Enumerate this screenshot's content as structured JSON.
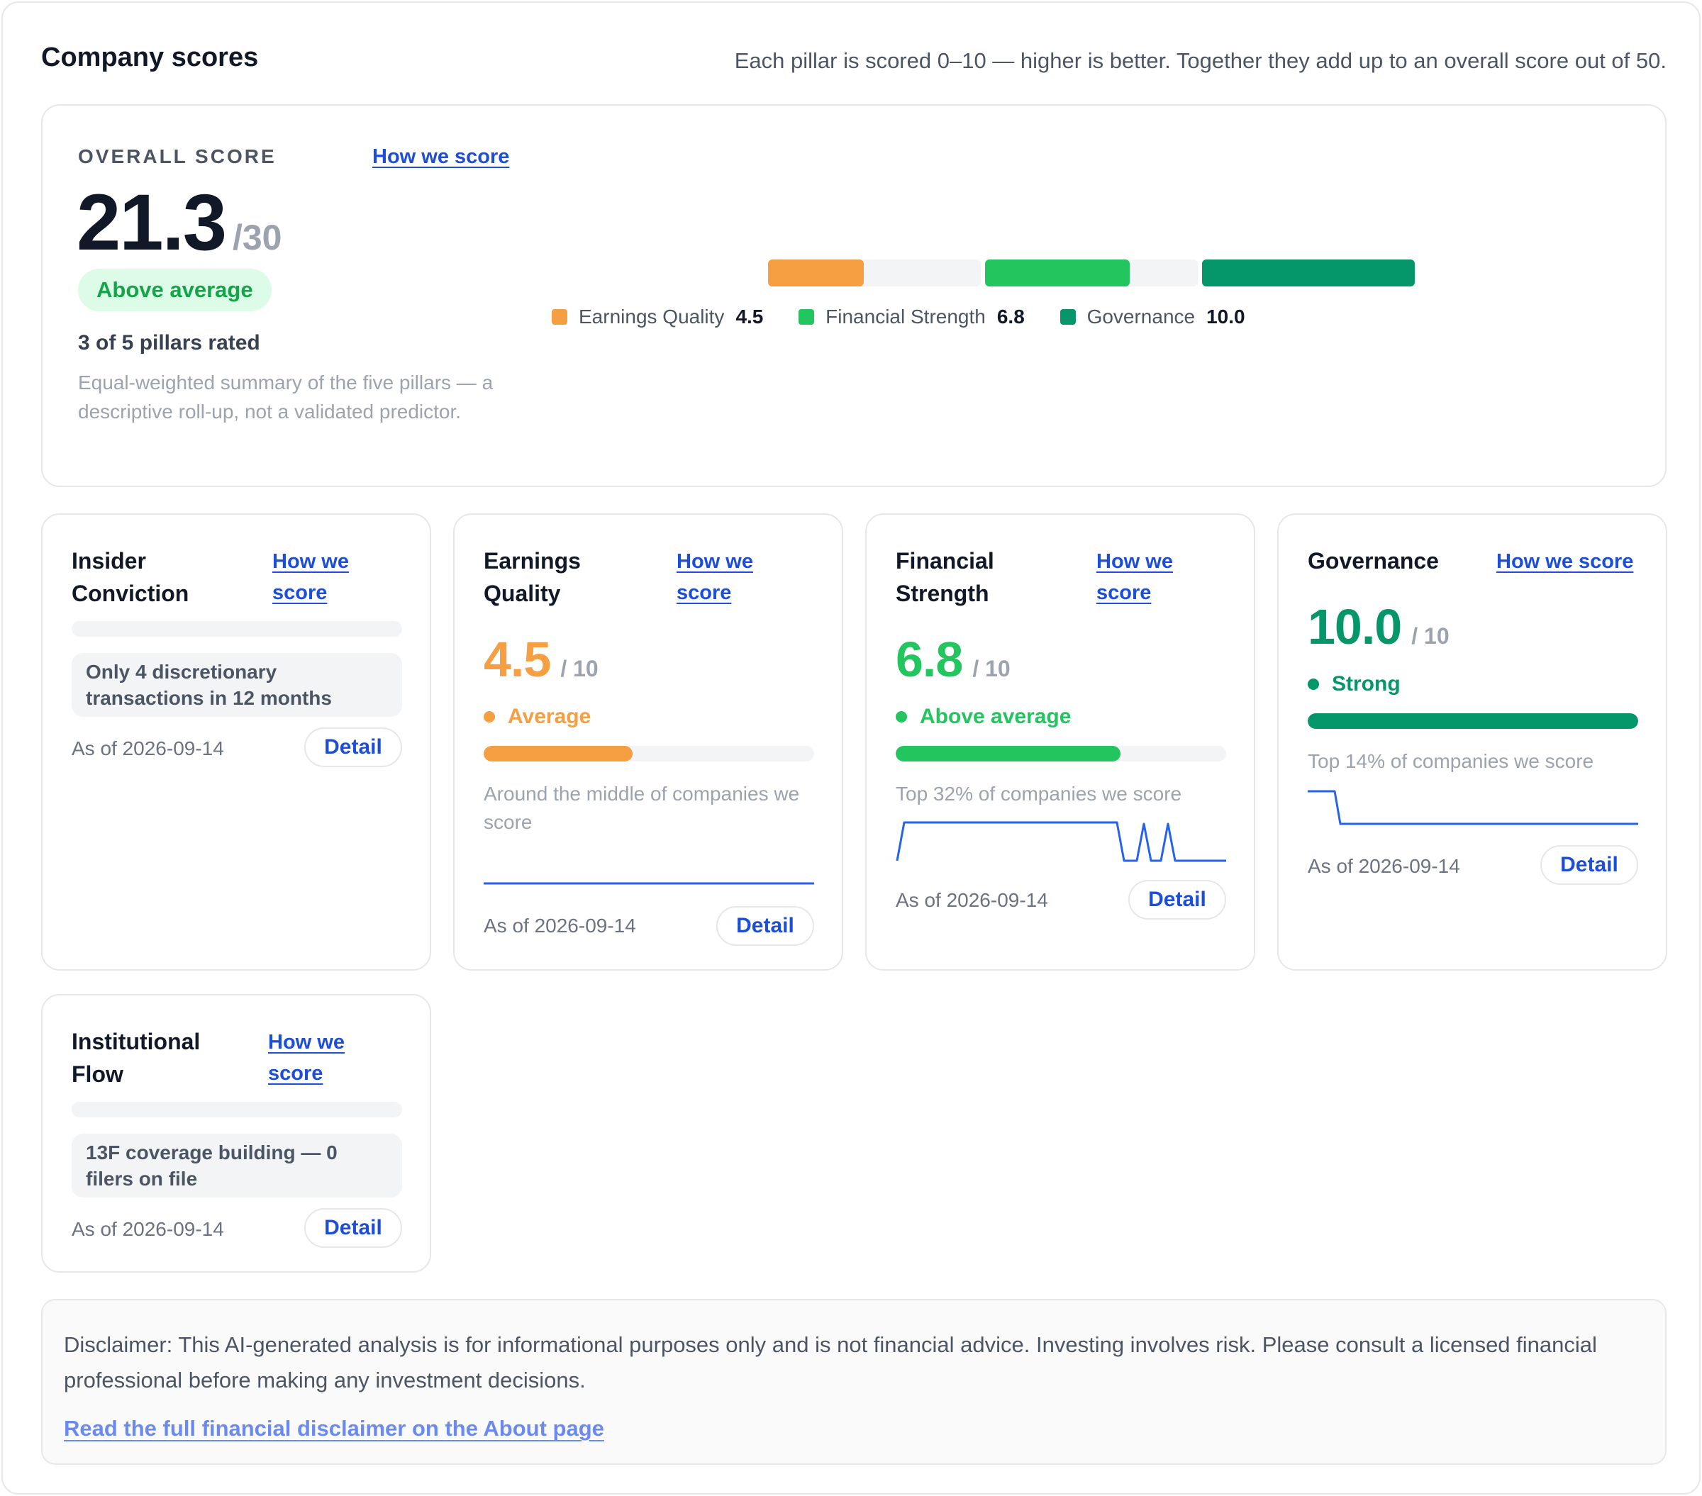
{
  "header": {
    "title": "Company scores",
    "subtitle": "Each pillar is scored 0–10 — higher is better. Together they add up to an overall score out of 50."
  },
  "overall": {
    "label": "OVERALL SCORE",
    "how_link": "How we score",
    "value": "21.3",
    "max": "/30",
    "badge": "Above average",
    "rated": "3 of 5 pillars rated",
    "description": "Equal-weighted summary of the five pillars — a descriptive roll-up, not a validated predictor.",
    "breakdown": [
      {
        "name": "Earnings Quality",
        "value": "4.5",
        "score": 4.5,
        "color": "#f59e42"
      },
      {
        "name": "Financial Strength",
        "value": "6.8",
        "score": 6.8,
        "color": "#22c55e"
      },
      {
        "name": "Governance",
        "value": "10.0",
        "score": 10.0,
        "color": "#059669"
      }
    ]
  },
  "pillars": {
    "insider": {
      "title": "Insider Conviction",
      "how_link": "How we score",
      "message": "Only 4 discretionary transactions in 12 months",
      "as_of": "As of 2026-09-14",
      "detail": "Detail"
    },
    "earnings": {
      "title": "Earnings Quality",
      "how_link": "How we score",
      "score": "4.5",
      "denominator": "/ 10",
      "status": "Average",
      "fill": 0.45,
      "color": "#f59e42",
      "note": "Around the middle of companies we score",
      "as_of": "As of 2026-09-14",
      "detail": "Detail"
    },
    "financial": {
      "title": "Financial Strength",
      "how_link": "How we score",
      "score": "6.8",
      "denominator": "/ 10",
      "status": "Above average",
      "fill": 0.68,
      "color": "#22c55e",
      "note": "Top 32% of companies we score",
      "as_of": "As of 2026-09-14",
      "detail": "Detail"
    },
    "governance": {
      "title": "Governance",
      "how_link": "How we score",
      "score": "10.0",
      "denominator": "/ 10",
      "status": "Strong",
      "fill": 1.0,
      "color": "#059669",
      "note": "Top 14% of companies we score",
      "as_of": "As of 2026-09-14",
      "detail": "Detail"
    },
    "institutional": {
      "title": "Institutional Flow",
      "how_link": "How we score",
      "message": "13F coverage building — 0 filers on file",
      "as_of": "As of 2026-09-14",
      "detail": "Detail"
    }
  },
  "colors": {
    "link": "#1d4ed8",
    "spark": "#2563eb"
  },
  "disclaimer": {
    "text": "Disclaimer: This AI-generated analysis is for informational purposes only and is not financial advice. Investing involves risk. Please consult a licensed financial professional before making any investment decisions.",
    "link": "Read the full financial disclaimer on the About page"
  }
}
